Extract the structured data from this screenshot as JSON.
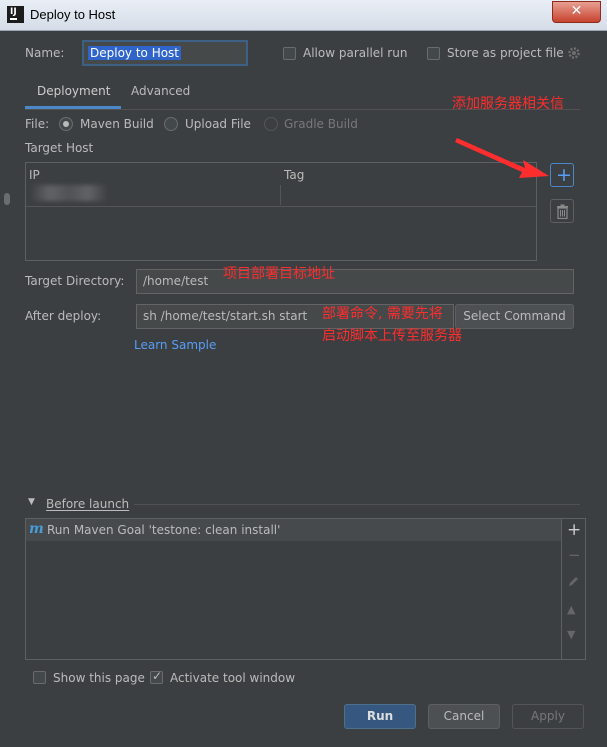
{
  "window": {
    "title": "Deploy to Host",
    "app_icon": "IJ",
    "close_glyph": "✕"
  },
  "form": {
    "name_label": "Name:",
    "name_value": "Deploy to Host",
    "allow_parallel_run": {
      "label": "Allow parallel run",
      "checked": false
    },
    "store_as_project_file": {
      "label": "Store as project file",
      "checked": false
    }
  },
  "tabs": [
    {
      "label": "Deployment",
      "selected": true
    },
    {
      "label": "Advanced",
      "selected": false
    }
  ],
  "file": {
    "label": "File:",
    "options": [
      {
        "label": "Maven Build",
        "selected": true,
        "enabled": true
      },
      {
        "label": "Upload File",
        "selected": false,
        "enabled": true
      },
      {
        "label": "Gradle Build",
        "selected": false,
        "enabled": false
      }
    ]
  },
  "target_host": {
    "label": "Target Host",
    "columns": [
      "IP",
      "Tag"
    ],
    "add_glyph": "+",
    "delete_icon": "trash-icon"
  },
  "target_directory": {
    "label": "Target Directory:",
    "value": "/home/test"
  },
  "after_deploy": {
    "label": "After deploy:",
    "value": "sh  /home/test/start.sh start",
    "select_command_label": "Select Command"
  },
  "learn_sample": "Learn Sample",
  "before_launch": {
    "label": "Before launch",
    "tasks": [
      {
        "icon": "m",
        "label": "Run Maven Goal 'testone: clean install'"
      }
    ],
    "side_add": "+",
    "side_remove": "−",
    "side_edit_icon": "pencil-icon",
    "side_up": "▲",
    "side_down": "▼"
  },
  "bottom_options": {
    "show_this_page": {
      "label": "Show this page",
      "checked": false
    },
    "activate_tool_window": {
      "label": "Activate tool window",
      "checked": true
    }
  },
  "buttons": {
    "run": "Run",
    "cancel": "Cancel",
    "apply": "Apply"
  },
  "annotations": {
    "add_server": "添加服务器相关信",
    "target_path": "项目部署目标地址",
    "deploy_cmd_line1": "部署命令, 需要先将",
    "deploy_cmd_line2": "启动脚本上传至服务器"
  },
  "colors": {
    "background": "#3c3f41",
    "accent": "#4a88c7",
    "link": "#589df6",
    "primary_button": "#365880",
    "annotation": "#ff2d2d"
  }
}
